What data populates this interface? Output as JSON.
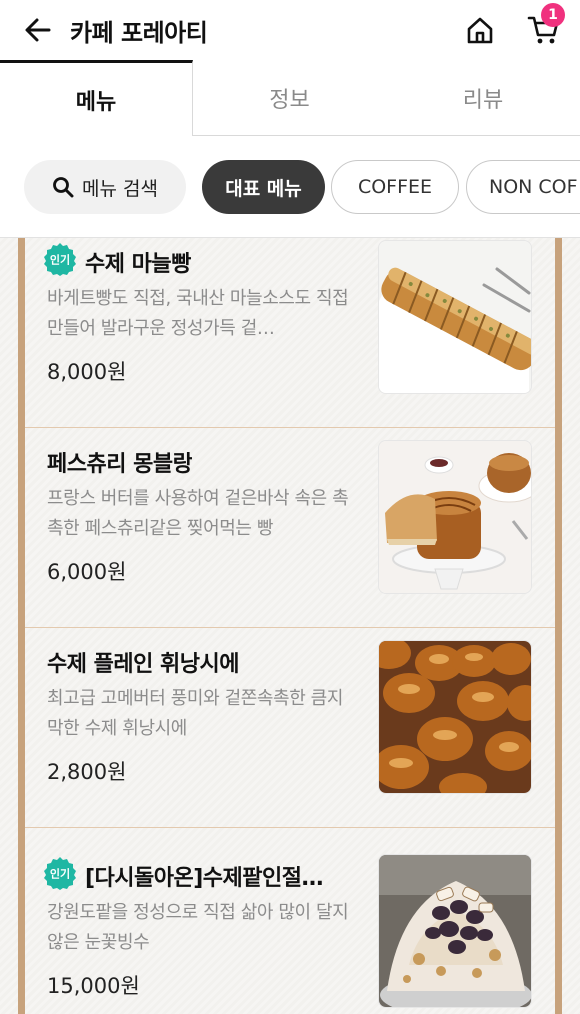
{
  "header": {
    "title": "카페 포레아티",
    "back_icon": "arrow-left-icon",
    "home_icon": "home-icon",
    "cart_icon": "cart-icon",
    "cart_count": "1",
    "badge_color": "#f0317e"
  },
  "tabs": [
    {
      "label": "메뉴",
      "active": true
    },
    {
      "label": "정보",
      "active": false
    },
    {
      "label": "리뷰",
      "active": false
    }
  ],
  "chips": {
    "search_label": "메뉴 검색",
    "search_icon": "search-icon",
    "items": [
      {
        "label": "대표 메뉴",
        "selected": true
      },
      {
        "label": "COFFEE",
        "selected": false
      },
      {
        "label": "NON COF",
        "selected": false
      }
    ]
  },
  "popular_badge": "인기",
  "menu_items": [
    {
      "name": "수제 마늘빵",
      "popular": true,
      "description": "바게트빵도 직접, 국내산 마늘소스도 직접 만들어 발라구운 정성가득 겉…",
      "price": "8,000원",
      "image": "garlic-bread"
    },
    {
      "name": "페스츄리 몽블랑",
      "popular": false,
      "description": "프랑스 버터를  사용하여 겉은바삭 속은 촉촉한 페스츄리같은 찢어먹는 빵",
      "price": "6,000원",
      "image": "mont-blanc"
    },
    {
      "name": "수제 플레인 휘낭시에",
      "popular": false,
      "description": "최고급 고메버터 풍미와 겉쫀속촉한 큼지막한 수제 휘낭시에",
      "price": "2,800원",
      "image": "financier"
    },
    {
      "name": "[다시돌아온]수제팥인절…",
      "popular": true,
      "description": "강원도팥을 정성으로 직접 삶아 많이 달지 않은 눈꽃빙수",
      "price": "15,000원",
      "image": "bingsu"
    }
  ]
}
